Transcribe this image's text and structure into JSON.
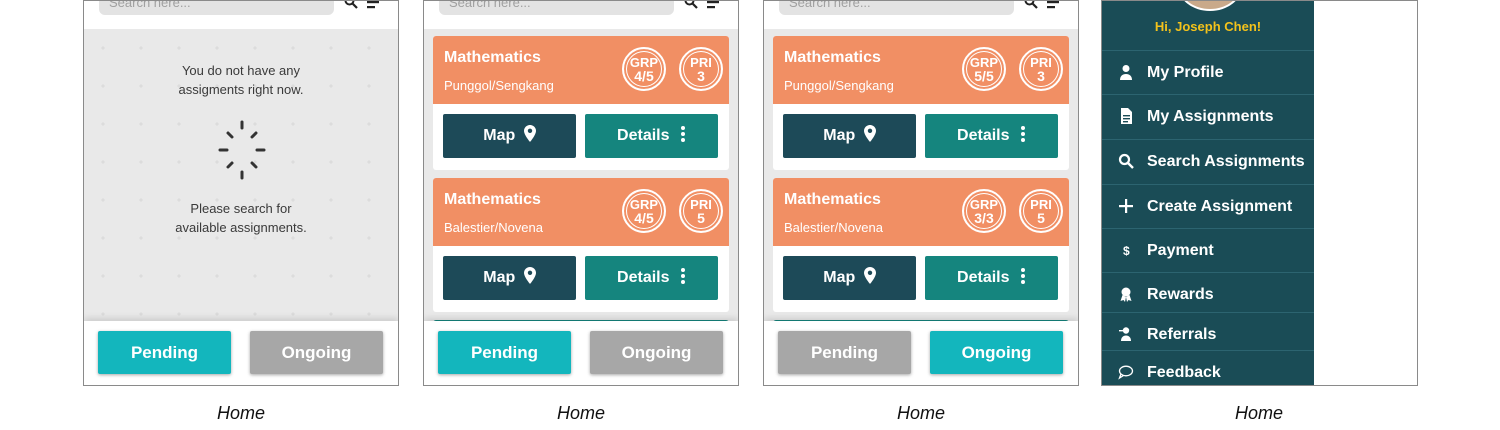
{
  "search": {
    "placeholder": "Search here..."
  },
  "panel1": {
    "empty_line1": "You do not have any",
    "empty_line2": "assigments right now.",
    "prompt_line1": "Please search for",
    "prompt_line2": "available assignments."
  },
  "tabs": {
    "pending": "Pending",
    "ongoing": "Ongoing"
  },
  "panel2": {
    "cards": [
      {
        "subject": "Mathematics",
        "area": "Punggol/Sengkang",
        "grp_label": "GRP",
        "grp": "4/5",
        "pri_label": "PRI",
        "pri": "3"
      },
      {
        "subject": "Mathematics",
        "area": "Balestier/Novena",
        "grp_label": "GRP",
        "grp": "4/5",
        "pri_label": "PRI",
        "pri": "5"
      }
    ]
  },
  "panel3": {
    "cards": [
      {
        "subject": "Mathematics",
        "area": "Punggol/Sengkang",
        "grp_label": "GRP",
        "grp": "5/5",
        "pri_label": "PRI",
        "pri": "3"
      },
      {
        "subject": "Mathematics",
        "area": "Balestier/Novena",
        "grp_label": "GRP",
        "grp": "3/3",
        "pri_label": "PRI",
        "pri": "5"
      }
    ]
  },
  "card_buttons": {
    "map": "Map",
    "details": "Details"
  },
  "menu": {
    "greeting": "Hi, Joseph Chen!",
    "items": [
      {
        "label": "My Profile",
        "icon": "user-icon"
      },
      {
        "label": "My Assignments",
        "icon": "document-icon"
      },
      {
        "label": "Search Assignments",
        "icon": "search-icon"
      },
      {
        "label": "Create Assignment",
        "icon": "plus-icon"
      },
      {
        "label": "Payment",
        "icon": "dollar-icon"
      },
      {
        "label": "Rewards",
        "icon": "ribbon-icon"
      },
      {
        "label": "Referrals",
        "icon": "user-add-icon"
      },
      {
        "label": "Feedback",
        "icon": "chat-bubble-icon"
      }
    ]
  },
  "captions": [
    "Home",
    "Home",
    "Home",
    "Home"
  ],
  "colors": {
    "accent_teal": "#13b6bd",
    "card_orange": "#f18f64",
    "navy": "#1d4a58",
    "dark_teal": "#15857e",
    "drawer": "#1a4c56",
    "greeting": "#f3c21b"
  }
}
